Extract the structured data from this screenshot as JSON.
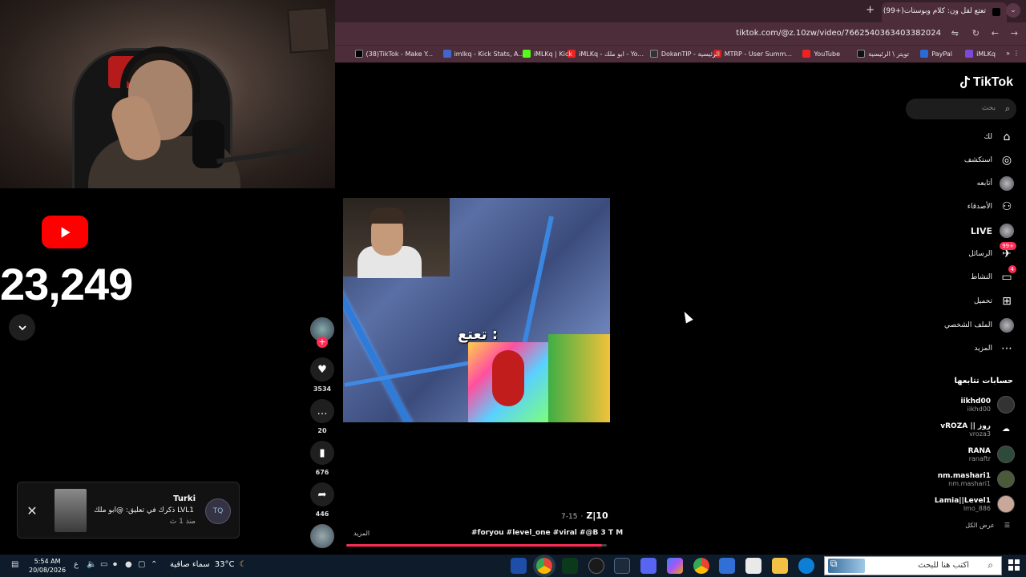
{
  "stream": {
    "subscriber_count": "23,249"
  },
  "notification": {
    "name": "Turki",
    "message": "ذكرك في تعليق: @ابو ملك LVL1",
    "time": "منذ 1 ث",
    "avatar_text": "TQ"
  },
  "browser": {
    "tab_title": "(99+)تعتع لقل ون: كلام وبوستات",
    "url": "tiktok.com/@z.10zw/video/7662540363403382024",
    "bookmarks": [
      "(38)TikTok - Make Y...",
      "imlkq - Kick Stats, A...",
      "iMLKq | Kick",
      "iMLKq - ابو ملك - Yo...",
      "DokanTIP - الرئيسية",
      "MTRP - User Summ...",
      "YouTube",
      "تويتر \\ الرئيسية",
      "PayPal",
      "iMLKq"
    ]
  },
  "tiktok": {
    "logo_text": "TikTok",
    "search_placeholder": "بحث",
    "nav": {
      "for_you": "لك",
      "explore": "استكشف",
      "following": "أتابعه",
      "friends": "الأصدقاء",
      "live": "LIVE",
      "messages": "الرسائل",
      "messages_badge": "99+",
      "activity": "النشاط",
      "activity_badge": "4",
      "upload": "تحميل",
      "profile": "الملف الشخصي",
      "more": "المزيد"
    },
    "following_heading": "حسابات تتابعها",
    "accounts": [
      {
        "name": "iikhd00",
        "handle": "iikhd00"
      },
      {
        "name": "vROZA || روز",
        "handle": "vroza3"
      },
      {
        "name": "RANA",
        "handle": "ranaftr"
      },
      {
        "name": "nm.mashari1",
        "handle": "nm.mashari1"
      },
      {
        "name": "Lamia||Level1",
        "handle": "lmo_886"
      }
    ],
    "see_all": "عرض الكل",
    "video": {
      "caption": "تعتع :",
      "author": "Z|10",
      "date": "7-15",
      "description": "#foryou #level_one #viral #@B 3 T M",
      "more": "المزيد",
      "progress": 0.98,
      "likes": "3534",
      "comments": "20",
      "saves": "676",
      "shares": "446"
    }
  },
  "taskbar": {
    "search_placeholder": "اكتب هنا للبحث",
    "weather_text": "سماء صافية",
    "temperature": "33°C",
    "time": "5:54 AM",
    "date": "20/08/2026",
    "lang": "ع"
  },
  "colors": {
    "youtube_red": "#ff0000",
    "tiktok_pink": "#fe2c55",
    "browser_chrome": "#4e2d3a"
  }
}
